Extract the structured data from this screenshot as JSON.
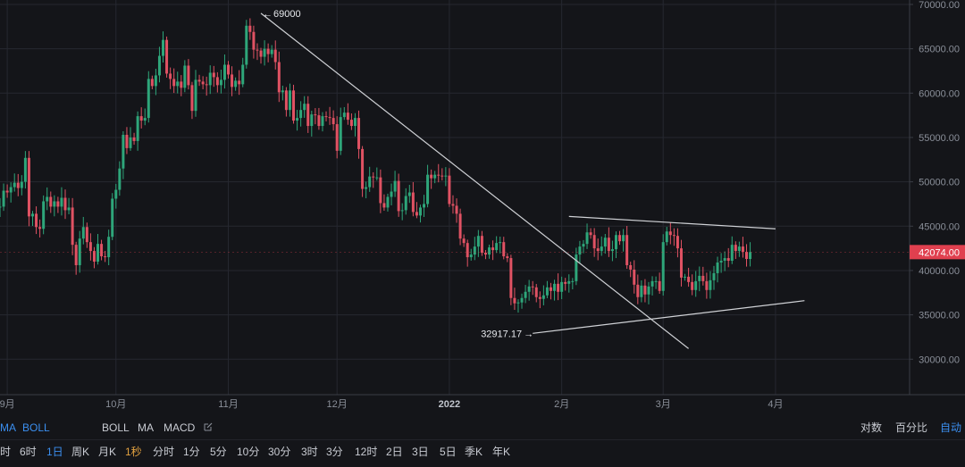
{
  "colors": {
    "background": "#141519",
    "up": "#2ea67a",
    "down": "#e05263",
    "grid": "#262830",
    "trendline": "#d0d2d6",
    "price_tag": "#e0404f",
    "accent_blue": "#3b8ff0",
    "accent_orange": "#e0a040"
  },
  "chart_data": {
    "type": "candlestick",
    "y_ticks": [
      "70000.00",
      "65000.00",
      "60000.00",
      "55000.00",
      "50000.00",
      "45000.00",
      "40000.00",
      "35000.00",
      "30000.00"
    ],
    "y_tick_values": [
      70000,
      65000,
      60000,
      55000,
      50000,
      45000,
      40000,
      35000,
      30000
    ],
    "ylim": [
      26000,
      70500
    ],
    "x_ticks": [
      {
        "label": "9月",
        "bold": false
      },
      {
        "label": "10月",
        "bold": false
      },
      {
        "label": "11月",
        "bold": false
      },
      {
        "label": "12月",
        "bold": false
      },
      {
        "label": "2022",
        "bold": true
      },
      {
        "label": "2月",
        "bold": false
      },
      {
        "label": "3月",
        "bold": false
      },
      {
        "label": "4月",
        "bold": false
      }
    ],
    "x_tick_dates": [
      "2021-09-01",
      "2021-10-01",
      "2021-11-01",
      "2021-12-01",
      "2022-01-01",
      "2022-02-01",
      "2022-03-01",
      "2022-04-01"
    ],
    "date_range": [
      "2021-08-30",
      "2022-05-08"
    ],
    "last_date": "2022-03-25",
    "annotations": [
      {
        "text": "69000",
        "date": "2021-11-10",
        "price": 69000,
        "side": "right"
      },
      {
        "text": "32917.17",
        "date": "2022-01-24",
        "price": 32917.17,
        "side": "left"
      }
    ],
    "current_price": "42074.00",
    "current_price_value": 42074,
    "trendlines": [
      {
        "name": "descending",
        "from": {
          "date": "2021-11-10",
          "price": 69000
        },
        "to": {
          "date": "2022-03-08",
          "price": 31200
        }
      },
      {
        "name": "upper",
        "from": {
          "date": "2022-02-03",
          "price": 46100
        },
        "to": {
          "date": "2022-04-01",
          "price": 44700
        }
      },
      {
        "name": "lower",
        "from": {
          "date": "2022-01-24",
          "price": 32917.17
        },
        "to": {
          "date": "2022-04-09",
          "price": 36600
        }
      }
    ],
    "closes": [
      47100,
      47200,
      49000,
      48800,
      49400,
      49900,
      49300,
      50000,
      52700,
      46100,
      46400,
      44900,
      44700,
      47800,
      48300,
      47200,
      47800,
      47200,
      48200,
      46800,
      47100,
      42900,
      40600,
      43600,
      44900,
      43200,
      42200,
      41000,
      43000,
      41600,
      41500,
      43800,
      48100,
      49100,
      51500,
      55300,
      53800,
      55000,
      54600,
      57400,
      56900,
      57200,
      61600,
      60800,
      62000,
      64200,
      66000,
      62200,
      61600,
      60800,
      61300,
      60600,
      63100,
      60900,
      58000,
      61500,
      61300,
      61000,
      60900,
      62300,
      61800,
      60900,
      61500,
      63200,
      62100,
      60700,
      61400,
      61000,
      63200,
      67600,
      66900,
      64900,
      64800,
      64100,
      65000,
      64400,
      64900,
      63500,
      60100,
      60300,
      58100,
      60300,
      56900,
      57200,
      58100,
      58800,
      56300,
      57600,
      57500,
      56300,
      57400,
      57300,
      57200,
      56500,
      53500,
      57300,
      57800,
      57000,
      56300,
      57200,
      53700,
      49200,
      49400,
      50600,
      50500,
      50500,
      47600,
      47100,
      48300,
      48900,
      50100,
      46700,
      46800,
      48400,
      48800,
      46600,
      46200,
      47100,
      47500,
      50800,
      50400,
      50800,
      50700,
      50600,
      50700,
      47500,
      47300,
      46400,
      43600,
      43100,
      41500,
      41800,
      42700,
      43900,
      42000,
      41800,
      42600,
      42300,
      43100,
      43200,
      41600,
      41400,
      36900,
      36300,
      36400,
      36900,
      37600,
      38200,
      38100,
      37000,
      36800,
      37200,
      38100,
      37700,
      38500,
      37600,
      38700,
      38500,
      38800,
      38800,
      41800,
      42700,
      43000,
      44300,
      44000,
      42500,
      42200,
      42700,
      43700,
      42200,
      42400,
      44000,
      43300,
      44000,
      40600,
      40100,
      38400,
      37000,
      38300,
      37300,
      38200,
      38800,
      38800,
      37700,
      43200,
      44400,
      44000,
      43900,
      42500,
      39200,
      39300,
      38700,
      37800,
      38800,
      39400,
      38800,
      37800,
      38900,
      39700,
      40900,
      41100,
      41400,
      41100,
      42900,
      42200,
      42700,
      42100,
      41300,
      42074
    ],
    "title": "",
    "xlabel": "",
    "ylabel": ""
  },
  "toolbar": {
    "left_indicators": [
      "MA",
      "BOLL"
    ],
    "sub_indicators": [
      "BOLL",
      "MA",
      "MACD"
    ],
    "right_modes": [
      "对数",
      "百分比",
      "自动"
    ],
    "intervals": [
      "时",
      "6时",
      "1日",
      "周K",
      "月K",
      "1秒",
      "分时",
      "1分",
      "5分",
      "10分",
      "30分",
      "3时",
      "3分",
      "12时",
      "2日",
      "3日",
      "5日",
      "季K",
      "年K"
    ],
    "active_interval": "1日",
    "highlight_interval": "1秒",
    "active_mode": "自动"
  }
}
